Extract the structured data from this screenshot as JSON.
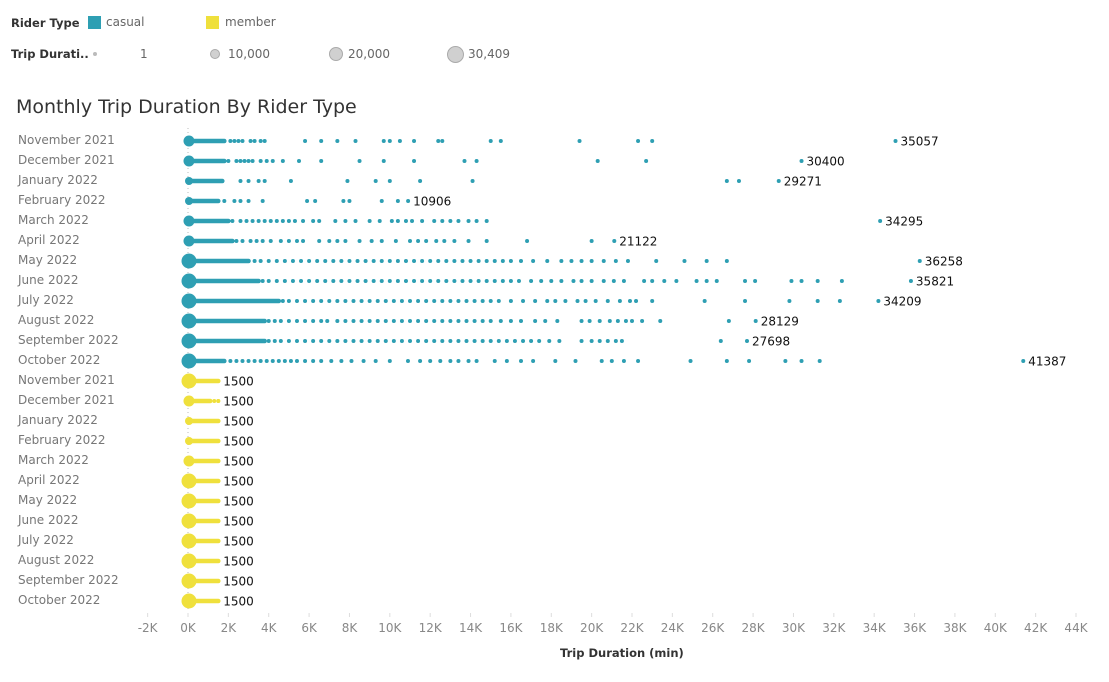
{
  "legend": {
    "color_title": "Rider Type",
    "color_items": [
      {
        "label": "casual",
        "color": "#2e9fb3"
      },
      {
        "label": "member",
        "color": "#efe03c"
      }
    ],
    "size_title": "Trip Durati..",
    "size_items": [
      "1",
      "10,000",
      "20,000",
      "30,409"
    ]
  },
  "chart_data": {
    "type": "scatter",
    "title": "Monthly Trip Duration By Rider Type",
    "xlabel": "Trip Duration (min)",
    "ylabel": "",
    "xlim": [
      -2000,
      44000
    ],
    "x_ticks": [
      "-2K",
      "0K",
      "2K",
      "4K",
      "6K",
      "8K",
      "10K",
      "12K",
      "14K",
      "16K",
      "18K",
      "20K",
      "22K",
      "24K",
      "26K",
      "28K",
      "30K",
      "32K",
      "34K",
      "36K",
      "38K",
      "40K",
      "42K",
      "44K"
    ],
    "x_tick_values": [
      -2000,
      0,
      2000,
      4000,
      6000,
      8000,
      10000,
      12000,
      14000,
      16000,
      18000,
      20000,
      22000,
      24000,
      26000,
      28000,
      30000,
      32000,
      34000,
      36000,
      38000,
      40000,
      42000,
      44000
    ],
    "grid": false,
    "legend_position": "top-left",
    "series": [
      {
        "name": "casual",
        "color": "#2e9fb3",
        "rows": [
          {
            "month": "November 2021",
            "dense_until": 1800,
            "origin_size": "medium",
            "points": [
              2100,
              2300,
              2500,
              2700,
              3100,
              3300,
              3600,
              3800,
              5800,
              6600,
              7400,
              8300,
              9700,
              10000,
              10500,
              11200,
              12400,
              12600,
              15000,
              15500,
              19400,
              22300,
              23000
            ],
            "max": 35057
          },
          {
            "month": "December 2021",
            "dense_until": 1800,
            "origin_size": "medium",
            "points": [
              2000,
              2400,
              2600,
              2800,
              3000,
              3200,
              3600,
              3900,
              4200,
              4700,
              5500,
              6600,
              8500,
              9700,
              11200,
              13700,
              14300,
              20300,
              22700
            ],
            "max": 30400
          },
          {
            "month": "January 2022",
            "dense_until": 1700,
            "origin_size": "small",
            "points": [
              2600,
              3000,
              3500,
              3800,
              5100,
              7900,
              9300,
              10000,
              11500,
              14100,
              26700,
              27300
            ],
            "max": 29271
          },
          {
            "month": "February 2022",
            "dense_until": 1500,
            "origin_size": "small",
            "points": [
              1800,
              2300,
              2600,
              3000,
              3700,
              5900,
              6300,
              7700,
              8000,
              9600,
              10400
            ],
            "max": 10906
          },
          {
            "month": "March 2022",
            "dense_until": 2000,
            "origin_size": "medium",
            "points": [
              2200,
              2600,
              2900,
              3200,
              3500,
              3800,
              4100,
              4400,
              4700,
              5000,
              5300,
              5700,
              6200,
              6500,
              7300,
              7800,
              8300,
              9000,
              9500,
              10100,
              10400,
              10800,
              11100,
              11600,
              12200,
              12600,
              13000,
              13400,
              13900,
              14300,
              14800
            ],
            "max": 34295
          },
          {
            "month": "April 2022",
            "dense_until": 2200,
            "origin_size": "medium",
            "points": [
              2400,
              2700,
              3100,
              3400,
              3700,
              4100,
              4600,
              5000,
              5400,
              5700,
              6500,
              7000,
              7400,
              7800,
              8500,
              9100,
              9600,
              10300,
              11000,
              11400,
              11800,
              12300,
              12700,
              13200,
              13900,
              14800,
              16800,
              20000
            ],
            "max": 21122
          },
          {
            "month": "May 2022",
            "dense_until": 3000,
            "origin_size": "large",
            "points": [
              3300,
              3600,
              4000,
              4400,
              4800,
              5200,
              5600,
              6000,
              6400,
              6800,
              7200,
              7600,
              8000,
              8400,
              8800,
              9200,
              9600,
              10000,
              10400,
              10800,
              11200,
              11600,
              12000,
              12400,
              12800,
              13200,
              13600,
              14000,
              14400,
              14800,
              15200,
              15600,
              16000,
              16500,
              17100,
              17800,
              18500,
              19000,
              19500,
              20000,
              20600,
              21200,
              21800,
              23200,
              24600,
              25700,
              26700
            ],
            "max": 36258
          },
          {
            "month": "June 2022",
            "dense_until": 3500,
            "origin_size": "large",
            "points": [
              3700,
              4000,
              4400,
              4800,
              5200,
              5600,
              6000,
              6400,
              6800,
              7200,
              7600,
              8000,
              8400,
              8800,
              9200,
              9600,
              10000,
              10400,
              10800,
              11200,
              11600,
              12000,
              12400,
              12800,
              13200,
              13600,
              14000,
              14400,
              14800,
              15200,
              15600,
              16000,
              16400,
              17000,
              17500,
              18000,
              18500,
              19100,
              19500,
              20000,
              20600,
              21100,
              21600,
              22600,
              23000,
              23600,
              24200,
              25200,
              25700,
              26200,
              27600,
              28100,
              29900,
              30400,
              31200,
              32400
            ],
            "max": 35821
          },
          {
            "month": "July 2022",
            "dense_until": 4500,
            "origin_size": "large",
            "points": [
              4700,
              5000,
              5400,
              5800,
              6200,
              6600,
              7000,
              7400,
              7800,
              8200,
              8600,
              9000,
              9400,
              9800,
              10200,
              10600,
              11000,
              11400,
              11800,
              12200,
              12600,
              13000,
              13400,
              13800,
              14200,
              14600,
              15000,
              15400,
              16000,
              16600,
              17200,
              17800,
              18200,
              18700,
              19300,
              19700,
              20200,
              20800,
              21400,
              21900,
              22200,
              23000,
              25600,
              27600,
              29800,
              31200,
              32300
            ],
            "max": 34209
          },
          {
            "month": "August 2022",
            "dense_until": 3800,
            "origin_size": "large",
            "points": [
              4000,
              4300,
              4600,
              5000,
              5400,
              5800,
              6200,
              6600,
              6900,
              7400,
              7800,
              8200,
              8600,
              9000,
              9400,
              9800,
              10200,
              10600,
              11000,
              11400,
              11800,
              12200,
              12600,
              13000,
              13400,
              13800,
              14200,
              14600,
              15000,
              15500,
              16000,
              16500,
              17200,
              17700,
              18300,
              19500,
              19900,
              20400,
              20900,
              21300,
              21700,
              22000,
              22500,
              23400,
              26800
            ],
            "max": 28129
          },
          {
            "month": "September 2022",
            "dense_until": 3800,
            "origin_size": "large",
            "points": [
              4000,
              4300,
              4600,
              5000,
              5400,
              5800,
              6200,
              6600,
              7000,
              7400,
              7800,
              8200,
              8600,
              9000,
              9400,
              9800,
              10200,
              10600,
              11000,
              11400,
              11800,
              12200,
              12600,
              13000,
              13400,
              13800,
              14200,
              14600,
              15000,
              15400,
              15800,
              16200,
              16600,
              17000,
              17400,
              17900,
              18400,
              19500,
              20000,
              20400,
              20800,
              21200,
              21500,
              26400
            ],
            "max": 27698
          },
          {
            "month": "October 2022",
            "dense_until": 1800,
            "origin_size": "large",
            "points": [
              2100,
              2400,
              2700,
              3000,
              3300,
              3600,
              3900,
              4200,
              4500,
              4800,
              5100,
              5400,
              5800,
              6200,
              6600,
              7100,
              7600,
              8100,
              8700,
              9300,
              10000,
              10900,
              11500,
              12000,
              12500,
              13000,
              13400,
              13900,
              14300,
              15200,
              15800,
              16500,
              17100,
              18200,
              19200,
              20500,
              21000,
              21600,
              22300,
              24900,
              26700,
              27800,
              29600,
              30400,
              31300
            ],
            "max": 41387
          }
        ]
      },
      {
        "name": "member",
        "color": "#efe03c",
        "rows": [
          {
            "month": "November 2021",
            "dense_until": 1500,
            "origin_size": "large",
            "max": 1500
          },
          {
            "month": "December 2021",
            "dense_until": 1100,
            "origin_size": "medium",
            "points": [
              1300,
              1500
            ],
            "max": 1500
          },
          {
            "month": "January 2022",
            "dense_until": 1500,
            "origin_size": "small",
            "max": 1500
          },
          {
            "month": "February 2022",
            "dense_until": 1500,
            "origin_size": "small",
            "max": 1500
          },
          {
            "month": "March 2022",
            "dense_until": 1500,
            "origin_size": "medium",
            "max": 1500
          },
          {
            "month": "April 2022",
            "dense_until": 1500,
            "origin_size": "large",
            "max": 1500
          },
          {
            "month": "May 2022",
            "dense_until": 1500,
            "origin_size": "large",
            "max": 1500
          },
          {
            "month": "June 2022",
            "dense_until": 1500,
            "origin_size": "large",
            "max": 1500
          },
          {
            "month": "July 2022",
            "dense_until": 1500,
            "origin_size": "large",
            "max": 1500
          },
          {
            "month": "August 2022",
            "dense_until": 1500,
            "origin_size": "large",
            "max": 1500
          },
          {
            "month": "September 2022",
            "dense_until": 1500,
            "origin_size": "large",
            "max": 1500
          },
          {
            "month": "October 2022",
            "dense_until": 1500,
            "origin_size": "large",
            "max": 1500
          }
        ]
      }
    ]
  }
}
